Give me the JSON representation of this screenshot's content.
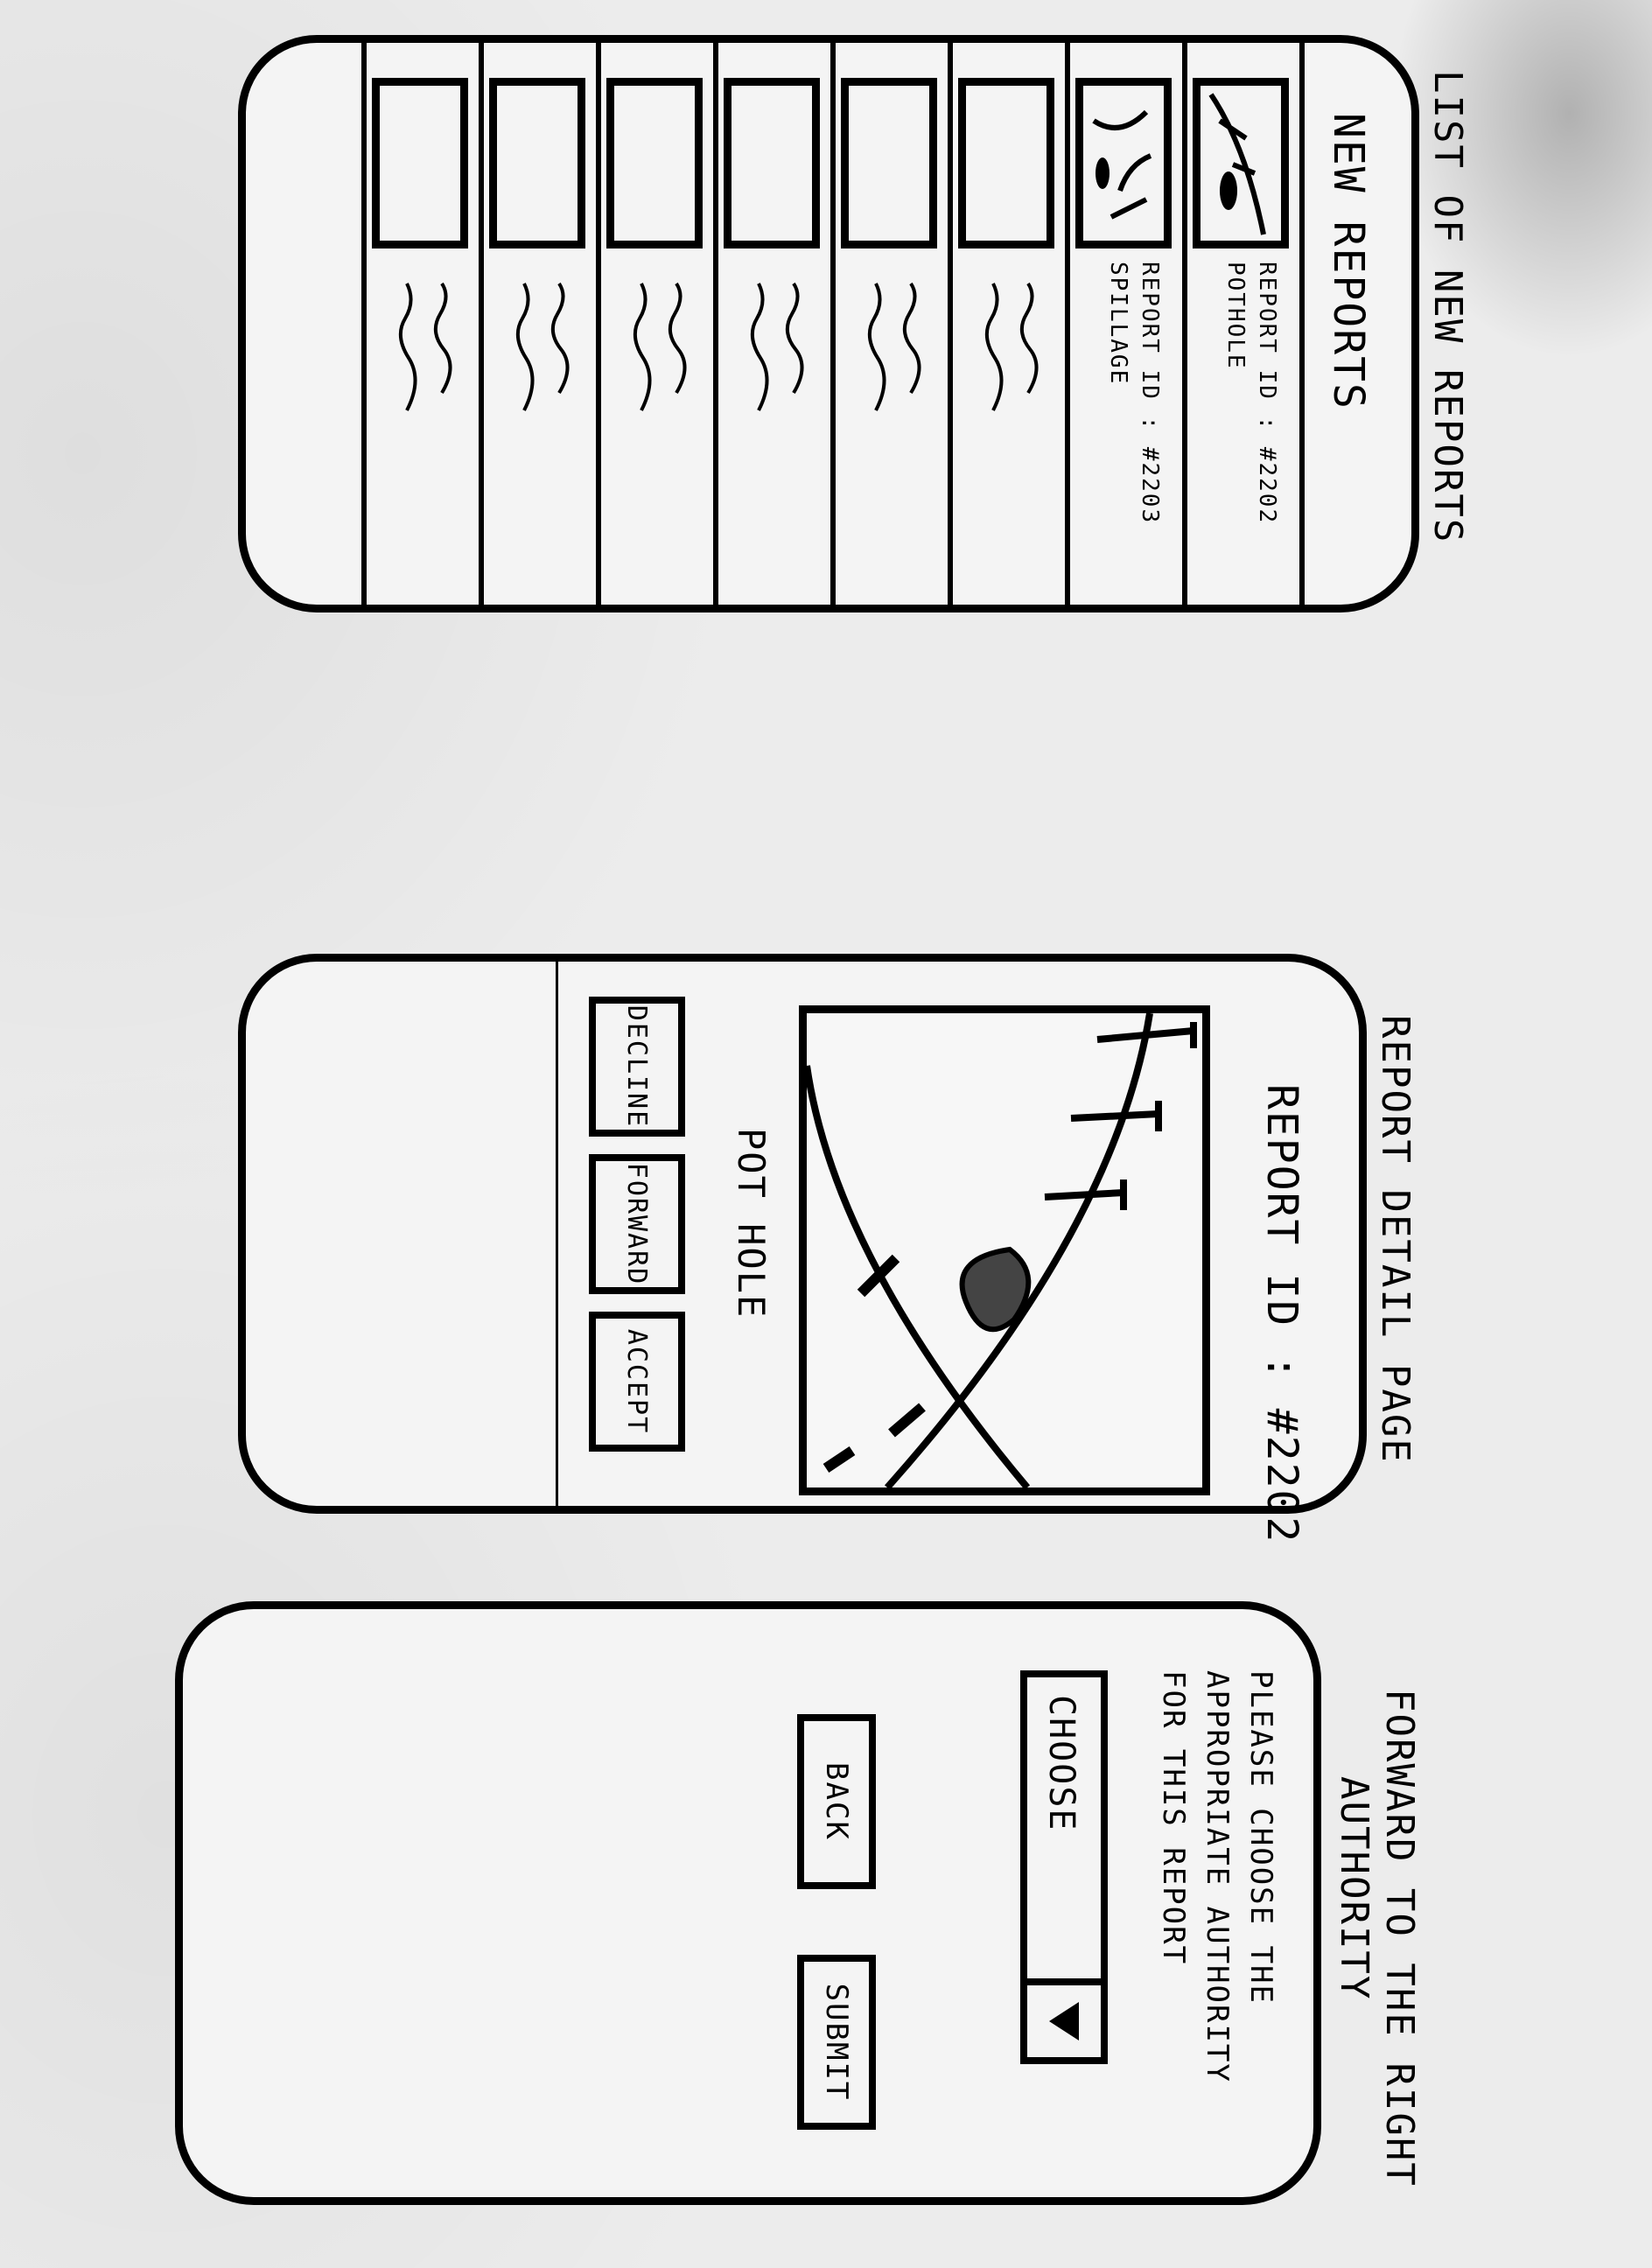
{
  "screens": {
    "list": {
      "caption": "LIST OF NEW REPORTS",
      "title": "NEW REPORTS",
      "items": [
        {
          "id_label": "REPORT ID : #2202",
          "type": "POTHOLE"
        },
        {
          "id_label": "REPORT ID : #2203",
          "type": "SPILLAGE"
        }
      ]
    },
    "detail": {
      "caption": "REPORT DETAIL PAGE",
      "title": "REPORT ID : #2202",
      "issue_label": "POT HOLE",
      "buttons": {
        "decline": "DECLINE",
        "forward": "FORWARD",
        "accept": "ACCEPT"
      }
    },
    "forward": {
      "caption_line1": "FORWARD TO THE RIGHT",
      "caption_line2": "AUTHORITY",
      "prompt_line1": "PLEASE CHOOSE THE",
      "prompt_line2": "APPROPRIATE AUTHORITY",
      "prompt_line3": "FOR THIS REPORT",
      "select_value": "CHOOSE",
      "buttons": {
        "back": "BACK",
        "submit": "SUBMIT"
      }
    }
  }
}
